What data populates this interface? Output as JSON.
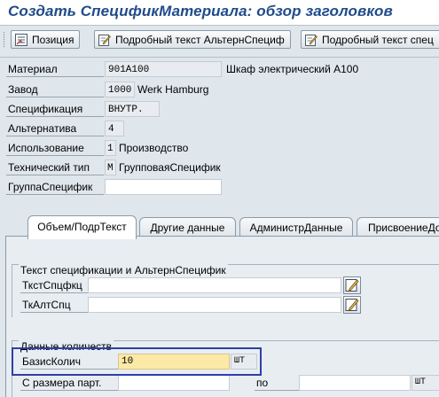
{
  "window": {
    "title": "Создать СпецификМатериала: обзор заголовков"
  },
  "toolbar": {
    "position_label": "Позиция",
    "detail_text_1_label": "Подробный текст АльтернСпециф",
    "detail_text_2_label": "Подробный текст спец"
  },
  "header": {
    "material": {
      "label": "Материал",
      "value": "901A100",
      "description": "Шкаф электрический A100"
    },
    "plant": {
      "label": "Завод",
      "value": "1000",
      "description": "Werk Hamburg"
    },
    "specification": {
      "label": "Спецификация",
      "value": "ВНУТР."
    },
    "alternative": {
      "label": "Альтернатива",
      "value": "4"
    },
    "usage": {
      "label": "Использование",
      "value": "1",
      "description": "Производство"
    },
    "tech_type": {
      "label": "Технический тип",
      "value": "M",
      "description": "ГрупповаяСпецифик"
    },
    "spec_group": {
      "label": "ГруппаСпецифик",
      "value": ""
    }
  },
  "tabs": [
    {
      "label": "Объем/ПодрТекст",
      "active": true
    },
    {
      "label": "Другие данные",
      "active": false
    },
    {
      "label": "АдминистрДанные",
      "active": false
    },
    {
      "label": "ПрисвоениеДо",
      "active": false
    }
  ],
  "spec_text_group": {
    "title": "Текст спецификации и АльтернСпецифик",
    "spec_text_label": "ТкстСпцфкц",
    "spec_text_value": "",
    "alt_text_label": "ТкАлтСпц",
    "alt_text_value": ""
  },
  "quantity_group": {
    "title": "Данные количеств",
    "base_qty_label": "БазисКолич",
    "base_qty_value": "10",
    "base_qty_unit": "ШТ",
    "lot_from_label": "С размера парт.",
    "lot_from_value": "",
    "lot_to_label": "по",
    "lot_to_value": "",
    "lot_unit": "ШТ"
  },
  "colors": {
    "title": "#1f4c8a",
    "background": "#dfe6ec",
    "highlight_border": "#2d3fa8",
    "required_field": "#fde9a7"
  },
  "icons": [
    "list-icon",
    "edit-text-icon",
    "edit-text-icon",
    "edit-pencil-icon"
  ]
}
